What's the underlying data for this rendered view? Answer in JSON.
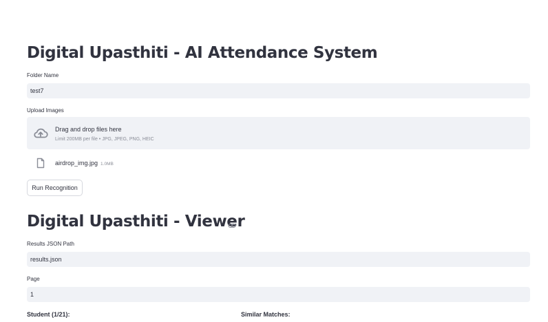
{
  "attendance": {
    "title": "Digital Upasthiti - AI Attendance System",
    "folder_label": "Folder Name",
    "folder_value": "test7",
    "upload_label": "Upload Images",
    "dropzone_title": "Drag and drop files here",
    "dropzone_limit": "Limit 200MB per file • JPG, JPEG, PNG, HEIC",
    "uploaded_file": {
      "name": "airdrop_img.jpg",
      "size": "1.0MB"
    },
    "run_button": "Run Recognition"
  },
  "viewer": {
    "title": "Digital Upasthiti - Viewer",
    "results_label": "Results JSON Path",
    "results_value": "results.json",
    "page_label": "Page",
    "page_value": "1",
    "student_header": "Student (1/21):",
    "matches_header": "Similar Matches:"
  },
  "icons": {
    "upload": "cloud-upload-icon",
    "file": "file-icon",
    "anchor": "link-icon"
  },
  "colors": {
    "input_bg": "#f0f2f6",
    "text": "#31333f",
    "muted": "#8a8d97"
  }
}
